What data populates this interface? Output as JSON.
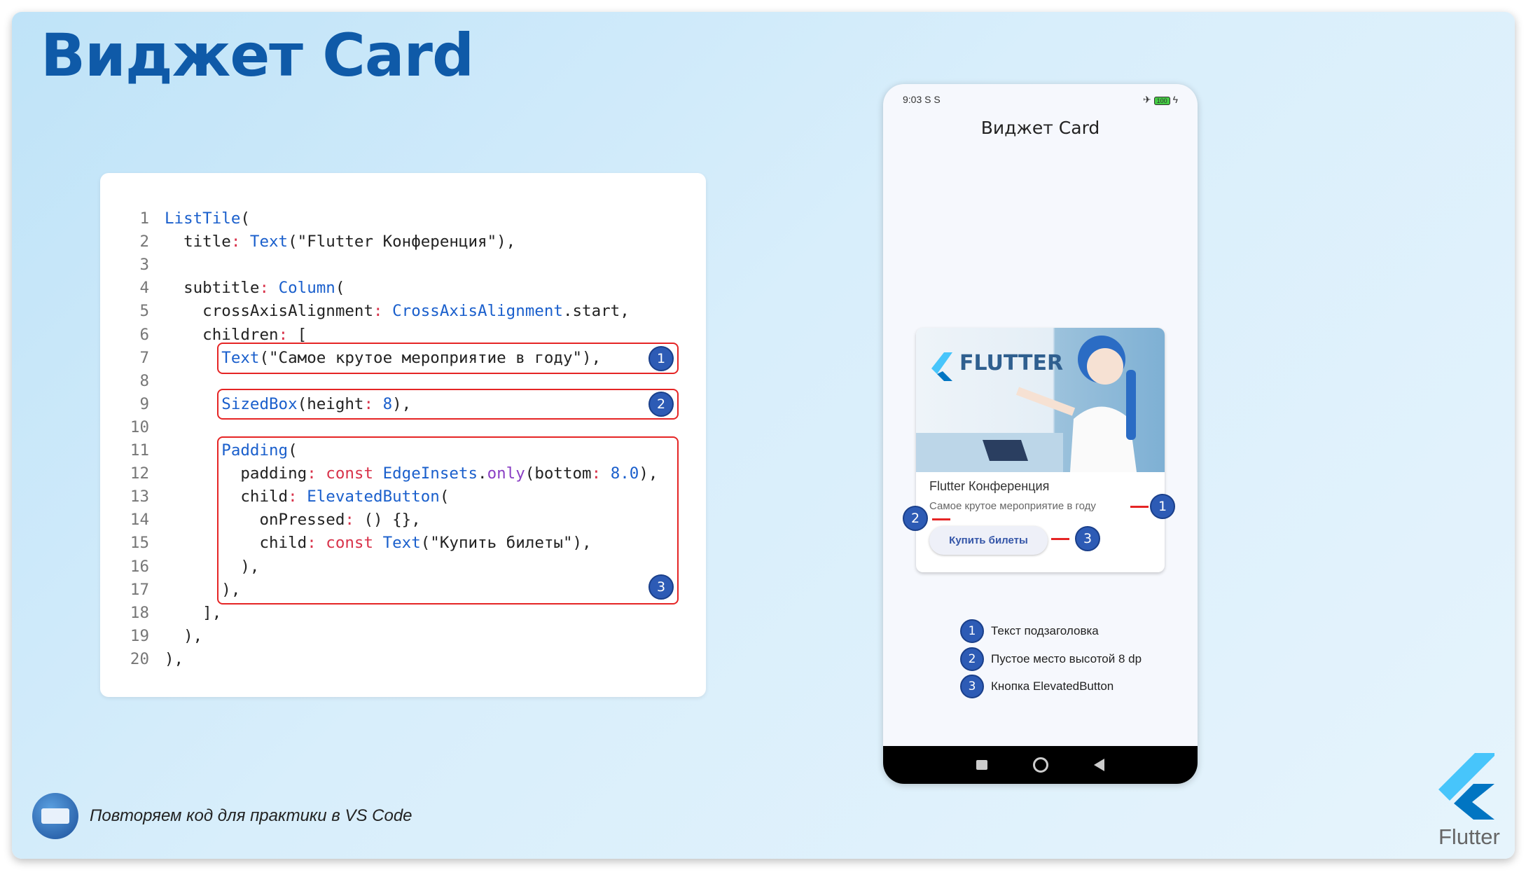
{
  "title": "Виджет Card",
  "code": {
    "lines": [
      [
        [
          "cls",
          "ListTile"
        ],
        [
          "",
          "("
        ]
      ],
      [
        [
          "",
          "  title"
        ],
        [
          "red",
          ": "
        ],
        [
          "cls",
          "Text"
        ],
        [
          "",
          "(\"Flutter Конференция\"),"
        ]
      ],
      [],
      [
        [
          "",
          "  subtitle"
        ],
        [
          "red",
          ": "
        ],
        [
          "cls",
          "Column"
        ],
        [
          "",
          "("
        ]
      ],
      [
        [
          "",
          "    crossAxisAlignment"
        ],
        [
          "red",
          ": "
        ],
        [
          "cls",
          "CrossAxisAlignment"
        ],
        [
          "",
          ".start,"
        ]
      ],
      [
        [
          "",
          "    children"
        ],
        [
          "red",
          ": "
        ],
        [
          "",
          "["
        ]
      ],
      [
        [
          "",
          "      "
        ],
        [
          "cls",
          "Text"
        ],
        [
          "",
          "(\"Самое крутое мероприятие в году\"),"
        ]
      ],
      [],
      [
        [
          "",
          "      "
        ],
        [
          "cls",
          "SizedBox"
        ],
        [
          "",
          "(height"
        ],
        [
          "red",
          ": "
        ],
        [
          "num",
          "8"
        ],
        [
          "",
          "),"
        ]
      ],
      [],
      [
        [
          "",
          "      "
        ],
        [
          "cls",
          "Padding"
        ],
        [
          "",
          "("
        ]
      ],
      [
        [
          "",
          "        padding"
        ],
        [
          "red",
          ": const "
        ],
        [
          "cls",
          "EdgeInsets"
        ],
        [
          "",
          "."
        ],
        [
          "pur",
          "only"
        ],
        [
          "",
          "(bottom"
        ],
        [
          "red",
          ": "
        ],
        [
          "num",
          "8.0"
        ],
        [
          "",
          "),"
        ]
      ],
      [
        [
          "",
          "        child"
        ],
        [
          "red",
          ": "
        ],
        [
          "cls",
          "ElevatedButton"
        ],
        [
          "",
          "("
        ]
      ],
      [
        [
          "",
          "          onPressed"
        ],
        [
          "red",
          ": "
        ],
        [
          "",
          "() {},"
        ]
      ],
      [
        [
          "",
          "          child"
        ],
        [
          "red",
          ": const "
        ],
        [
          "cls",
          "Text"
        ],
        [
          "",
          "(\"Купить билеты\"),"
        ]
      ],
      [
        [
          "",
          "        ),"
        ]
      ],
      [
        [
          "",
          "      ),"
        ]
      ],
      [
        [
          "",
          "    ],"
        ]
      ],
      [
        [
          "",
          "  ),"
        ]
      ],
      [
        [
          "",
          "),"
        ]
      ]
    ],
    "markers": [
      "1",
      "2",
      "3"
    ]
  },
  "phone": {
    "time": "9:03",
    "status_icons": "S  S",
    "battery": "100",
    "app_title": "Виджет Card",
    "image_text": "FLUTTER",
    "card_title": "Flutter Конференция",
    "card_subtitle": "Самое крутое мероприятие в году",
    "button": "Купить билеты",
    "legend": [
      {
        "n": "1",
        "text": "Текст подзаголовка"
      },
      {
        "n": "2",
        "text": "Пустое место высотой 8 dp"
      },
      {
        "n": "3",
        "text": "Кнопка ElevatedButton"
      }
    ]
  },
  "footer": {
    "text": "Повторяем код для практики в VS Code"
  },
  "brand": {
    "text": "Flutter"
  }
}
